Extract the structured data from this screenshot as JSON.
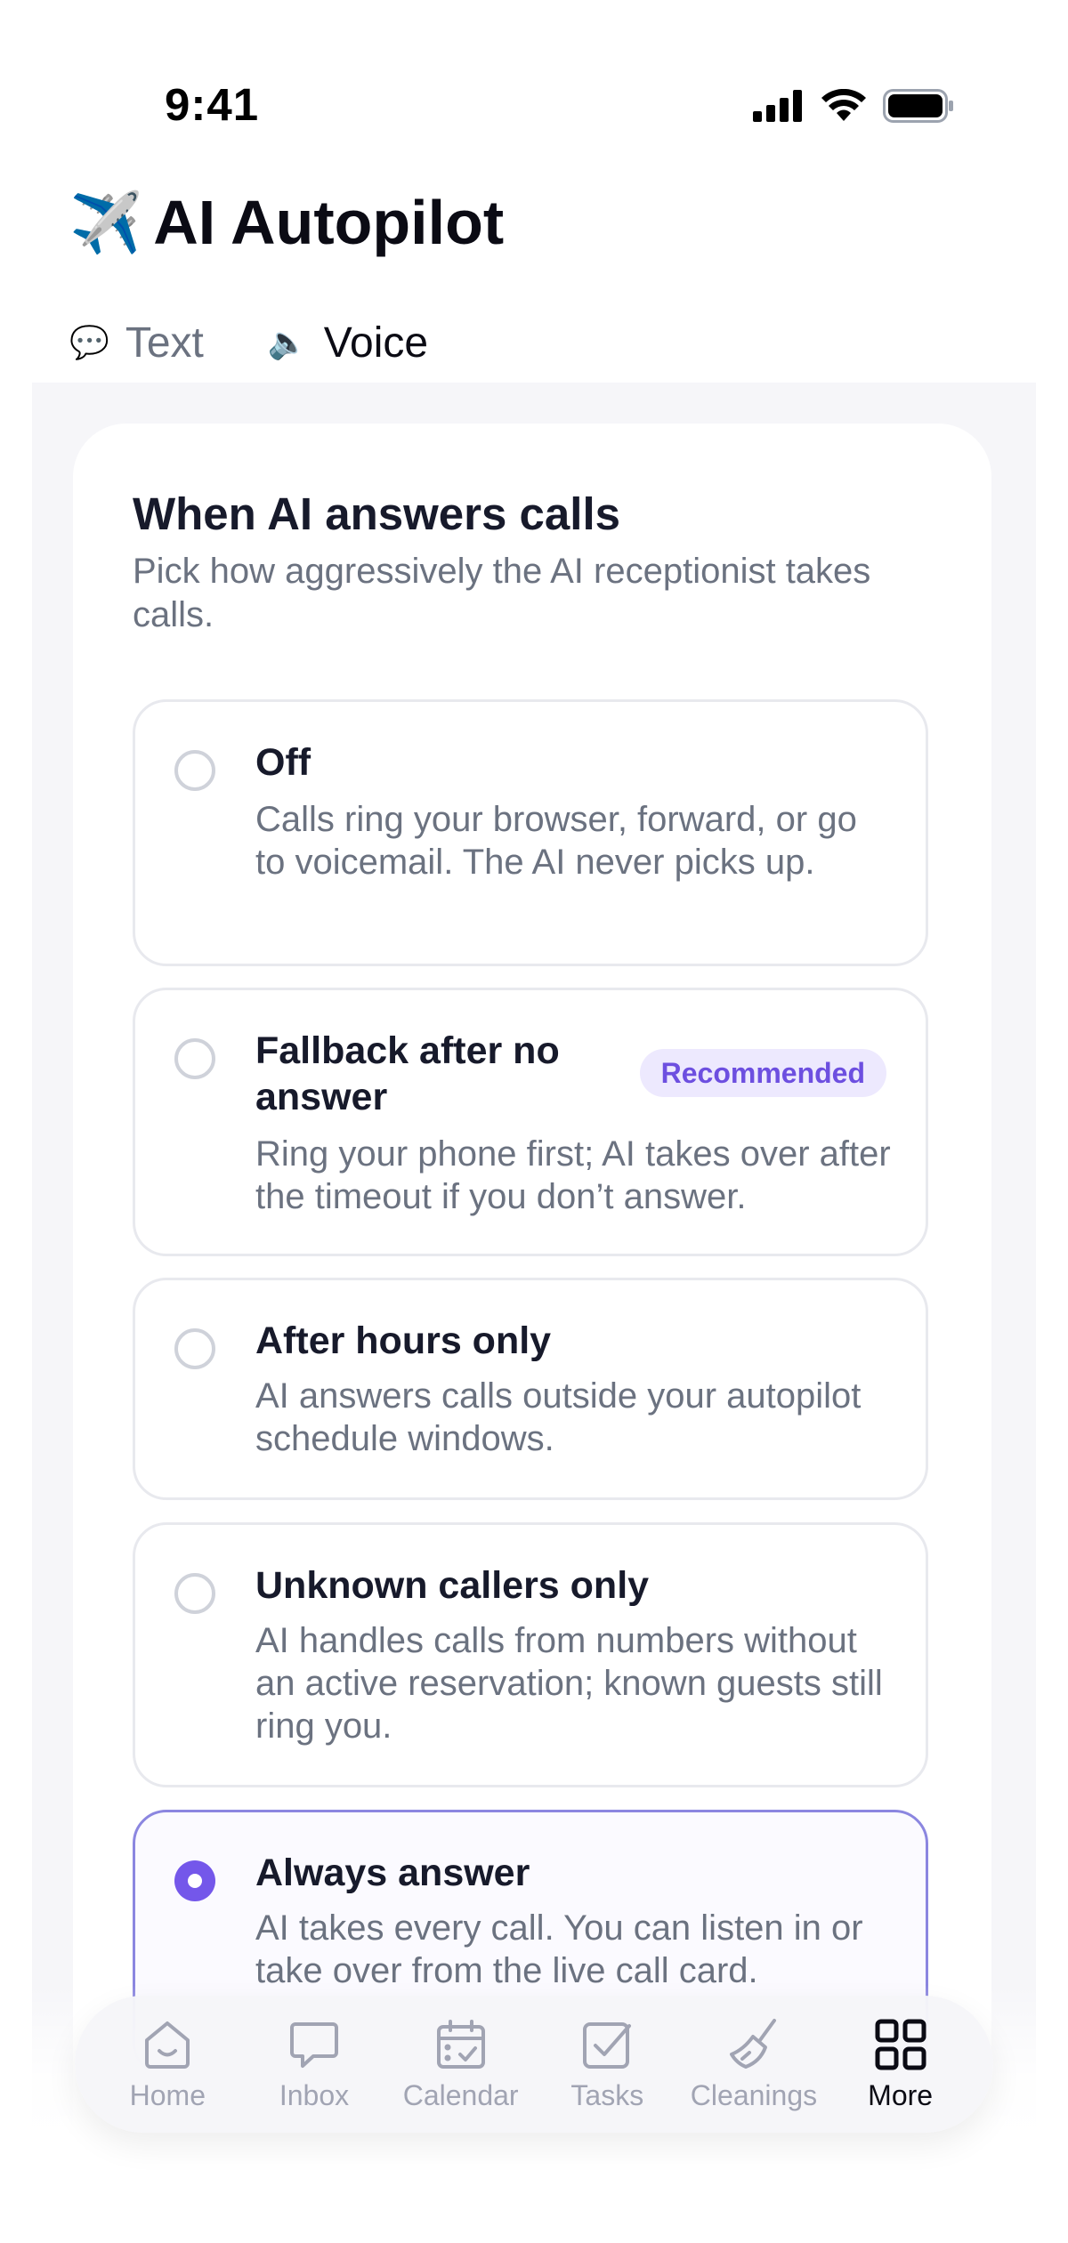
{
  "status_bar": {
    "time": "9:41"
  },
  "header": {
    "title_emoji": "✈️",
    "title": "AI Autopilot"
  },
  "tabs": [
    {
      "icon": "💬",
      "label": "Text",
      "active": false
    },
    {
      "icon": "🔈",
      "label": "Voice",
      "active": true
    }
  ],
  "card": {
    "title": "When AI answers calls",
    "subtitle": "Pick how aggressively the AI receptionist takes calls.",
    "options": [
      {
        "title": "Off",
        "description": "Calls ring your browser, forward, or go to voicemail. The AI never picks up.",
        "selected": false
      },
      {
        "title": "Fallback after no answer",
        "badge": "Recommended",
        "description": "Ring your phone first; AI takes over after the timeout if you don’t answer.",
        "selected": false
      },
      {
        "title": "After hours only",
        "description": "AI answers calls outside your autopilot schedule windows.",
        "selected": false
      },
      {
        "title": "Unknown callers only",
        "description": "AI handles calls from numbers without an active reservation; known guests still ring you.",
        "selected": false
      },
      {
        "title": "Always answer",
        "description": "AI takes every call. You can listen in or take over from the live call card.",
        "selected": true
      }
    ]
  },
  "bottom_nav": [
    {
      "label": "Home",
      "icon": "home-icon",
      "active": false
    },
    {
      "label": "Inbox",
      "icon": "chat-bubble-icon",
      "active": false
    },
    {
      "label": "Calendar",
      "icon": "calendar-icon",
      "active": false
    },
    {
      "label": "Tasks",
      "icon": "checkbox-icon",
      "active": false
    },
    {
      "label": "Cleanings",
      "icon": "broom-icon",
      "active": false
    },
    {
      "label": "More",
      "icon": "grid-icon",
      "active": true
    }
  ],
  "colors": {
    "accent": "#7457ea",
    "badge_bg": "#ede9fe",
    "text_muted": "#6b7280"
  }
}
